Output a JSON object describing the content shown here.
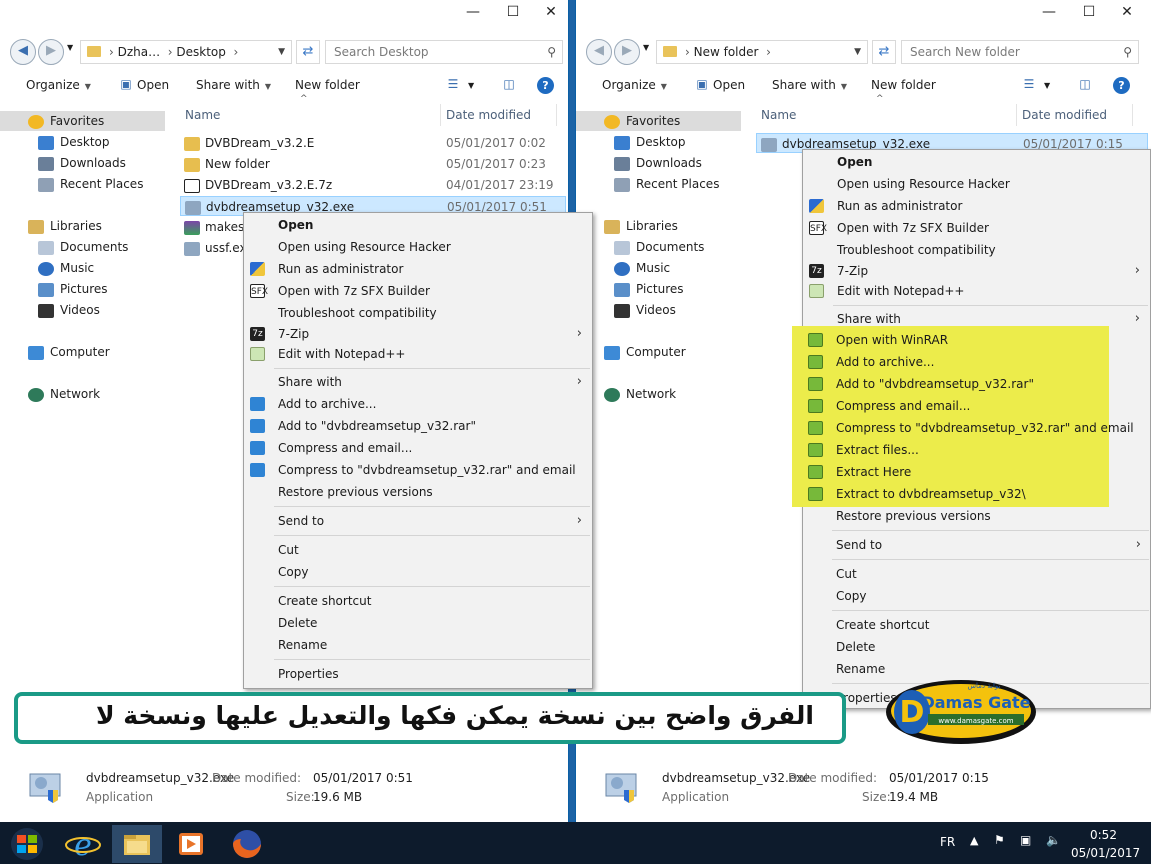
{
  "left": {
    "address": [
      "Dzha…",
      "Desktop"
    ],
    "search_placeholder": "Search Desktop",
    "toolbar": {
      "organize": "Organize",
      "open": "Open",
      "share_with": "Share with",
      "new_folder": "New folder"
    },
    "nav": {
      "favorites": "Favorites",
      "desktop": "Desktop",
      "downloads": "Downloads",
      "recent": "Recent Places",
      "libraries": "Libraries",
      "documents": "Documents",
      "music": "Music",
      "pictures": "Pictures",
      "videos": "Videos",
      "computer": "Computer",
      "network": "Network"
    },
    "columns": {
      "name": "Name",
      "date": "Date modified"
    },
    "files": [
      {
        "name": "DVBDream_v3.2.E",
        "date": "05/01/2017 0:02"
      },
      {
        "name": "New folder",
        "date": "05/01/2017 0:23"
      },
      {
        "name": "DVBDream_v3.2.E.7z",
        "date": "04/01/2017 23:19"
      },
      {
        "name": "dvbdreamsetup_v32.exe",
        "date": "05/01/2017 0:51"
      },
      {
        "name": "makesf",
        "date": ""
      },
      {
        "name": "ussf.exe",
        "date": ""
      }
    ],
    "menu": [
      "Open",
      "Open using Resource Hacker",
      "Run as administrator",
      "Open with 7z SFX Builder",
      "Troubleshoot compatibility",
      "7-Zip",
      "Edit with Notepad++",
      "Share with",
      "Add to archive...",
      "Add to \"dvbdreamsetup_v32.rar\"",
      "Compress and email...",
      "Compress to \"dvbdreamsetup_v32.rar\" and email",
      "Restore previous versions",
      "Send to",
      "Cut",
      "Copy",
      "Create shortcut",
      "Delete",
      "Rename",
      "Properties"
    ],
    "details": {
      "name": "dvbdreamsetup_v32.exe",
      "type": "Application",
      "date_label": "Date modified:",
      "date": "05/01/2017 0:51",
      "size_label": "Size:",
      "size": "19.6 MB"
    }
  },
  "right": {
    "address": [
      "New folder"
    ],
    "search_placeholder": "Search New folder",
    "toolbar": {
      "organize": "Organize",
      "open": "Open",
      "share_with": "Share with",
      "new_folder": "New folder"
    },
    "nav": {
      "favorites": "Favorites",
      "desktop": "Desktop",
      "downloads": "Downloads",
      "recent": "Recent Places",
      "libraries": "Libraries",
      "documents": "Documents",
      "music": "Music",
      "pictures": "Pictures",
      "videos": "Videos",
      "computer": "Computer",
      "network": "Network"
    },
    "columns": {
      "name": "Name",
      "date": "Date modified"
    },
    "files": [
      {
        "name": "dvbdreamsetup_v32.exe",
        "date": "05/01/2017 0:15"
      }
    ],
    "menu": [
      "Open",
      "Open using Resource Hacker",
      "Run as administrator",
      "Open with 7z SFX Builder",
      "Troubleshoot compatibility",
      "7-Zip",
      "Edit with Notepad++",
      "Share with",
      "Open with WinRAR",
      "Add to archive...",
      "Add to \"dvbdreamsetup_v32.rar\"",
      "Compress and email...",
      "Compress to \"dvbdreamsetup_v32.rar\" and email",
      "Extract files...",
      "Extract Here",
      "Extract to dvbdreamsetup_v32\\",
      "Restore previous versions",
      "Send to",
      "Cut",
      "Copy",
      "Create shortcut",
      "Delete",
      "Rename",
      "Properties"
    ],
    "details": {
      "name": "dvbdreamsetup_v32.exe",
      "type": "Application",
      "date_label": "Date modified:",
      "date": "05/01/2017 0:15",
      "size_label": "Size:",
      "size": "19.4 MB"
    }
  },
  "banner_text": "الفرق واضح بين نسخة يمكن فكها والتعديل عليها ونسخة لا",
  "logo": {
    "name": "Damas Gate",
    "url": "www.damasgate.com",
    "arabic": "بوابة دماس"
  },
  "taskbar": {
    "lang": "FR",
    "time": "0:52",
    "date": "05/01/2017"
  },
  "colors": {
    "highlight": "#ecec4b",
    "banner_border": "#1a9a86",
    "selection": "#cce8ff",
    "taskbar": "#0d1b2c"
  }
}
